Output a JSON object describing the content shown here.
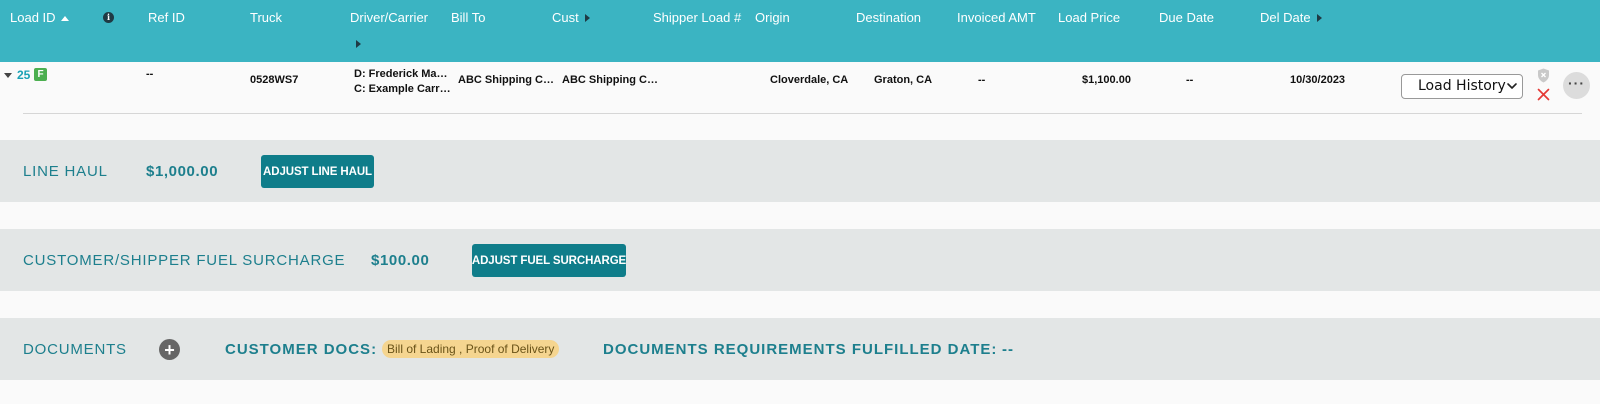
{
  "header": {
    "columns": [
      {
        "label": "Load ID"
      },
      {
        "label": ""
      },
      {
        "label": "Ref ID"
      },
      {
        "label": "Truck"
      },
      {
        "label": "Driver/Carrier"
      },
      {
        "label": "Bill To"
      },
      {
        "label": "Cust"
      },
      {
        "label": "Shipper Load #"
      },
      {
        "label": "Origin"
      },
      {
        "label": "Destination"
      },
      {
        "label": "Invoiced AMT"
      },
      {
        "label": "Load Price"
      },
      {
        "label": "Due Date"
      },
      {
        "label": "Del Date"
      }
    ]
  },
  "row": {
    "load_id": "25",
    "badge": "F",
    "ref_id": "--",
    "truck": "0528WS7",
    "driver": "D: Frederick Mar…",
    "carrier": "C: Example Carri…",
    "bill_to": "ABC Shipping Co…",
    "cust": "ABC Shipping Co…",
    "shipper_load": "",
    "origin": "Cloverdale, CA",
    "destination": "Graton, CA",
    "invoiced_amt": "--",
    "load_price": "$1,100.00",
    "due_date": "--",
    "del_date": "10/30/2023",
    "select_value": "Load History"
  },
  "line_haul": {
    "title": "LINE HAUL",
    "amount": "$1,000.00",
    "button": "ADJUST LINE HAUL"
  },
  "fuel": {
    "title": "CUSTOMER/SHIPPER FUEL SURCHARGE",
    "amount": "$100.00",
    "button": "ADJUST FUEL SURCHARGE"
  },
  "documents": {
    "title": "DOCUMENTS",
    "customer_docs_label": "CUSTOMER DOCS:",
    "customer_docs_value": "Bill of Lading , Proof of Delivery",
    "fulfilled_label": "DOCUMENTS REQUIREMENTS FULFILLED DATE:",
    "fulfilled_value": "--"
  },
  "colors": {
    "header_bg": "#3bb4c2",
    "accent": "#1d7f8d",
    "button_bg": "#0f7d8a",
    "section_bg": "#e3e6e6",
    "badge_bg": "#f5d590",
    "f_badge": "#4caf50",
    "close_red": "#e53935"
  },
  "icons": [
    "sort-up-icon",
    "info-icon",
    "chevron-right-icon",
    "expand-icon",
    "shield-icon",
    "close-icon",
    "more-icon",
    "add-icon",
    "chevron-down-icon"
  ]
}
